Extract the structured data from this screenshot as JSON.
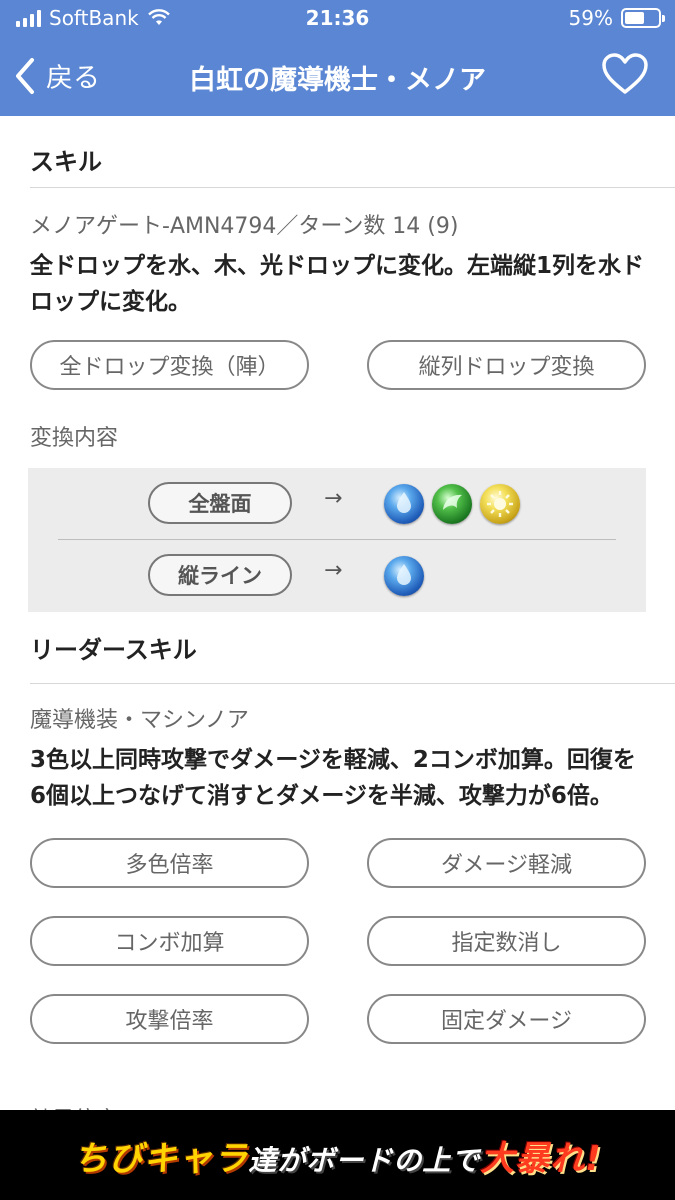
{
  "status": {
    "carrier": "SoftBank",
    "time": "21:36",
    "battery_percent": "59%",
    "battery_level": 0.59
  },
  "nav": {
    "back_label": "戻る",
    "title": "白虹の魔導機士・メノア"
  },
  "skill": {
    "header": "スキル",
    "name": "メノアゲート-AMN4794／ターン数 14 (9)",
    "description": "全ドロップを水、木、光ドロップに変化。左端縦1列を水ドロップに変化。",
    "tags": [
      "全ドロップ変換（陣）",
      "縦列ドロップ変換"
    ],
    "conversion_label": "変換内容",
    "conversions": [
      {
        "area": "全盤面",
        "arrow": "→",
        "orbs": [
          "water",
          "wood",
          "light"
        ]
      },
      {
        "area": "縦ライン",
        "arrow": "→",
        "orbs": [
          "water"
        ]
      }
    ]
  },
  "leader_skill": {
    "header": "リーダースキル",
    "name": "魔導機装・マシンノア",
    "description": "3色以上同時攻撃でダメージを軽減、2コンボ加算。回復を6個以上つなげて消すとダメージを半減、攻撃力が6倍。",
    "tags": [
      "多色倍率",
      "ダメージ軽減",
      "コンボ加算",
      "指定数消し",
      "攻撃倍率",
      "固定ダメージ"
    ]
  },
  "partial_next_label": "効果倍率",
  "banner": {
    "part1": "ちびキャラ",
    "part2": "達がボードの上で",
    "part3": "大暴れ!"
  },
  "colors": {
    "header_blue": "#5a86d3",
    "banner_black": "#000000"
  }
}
